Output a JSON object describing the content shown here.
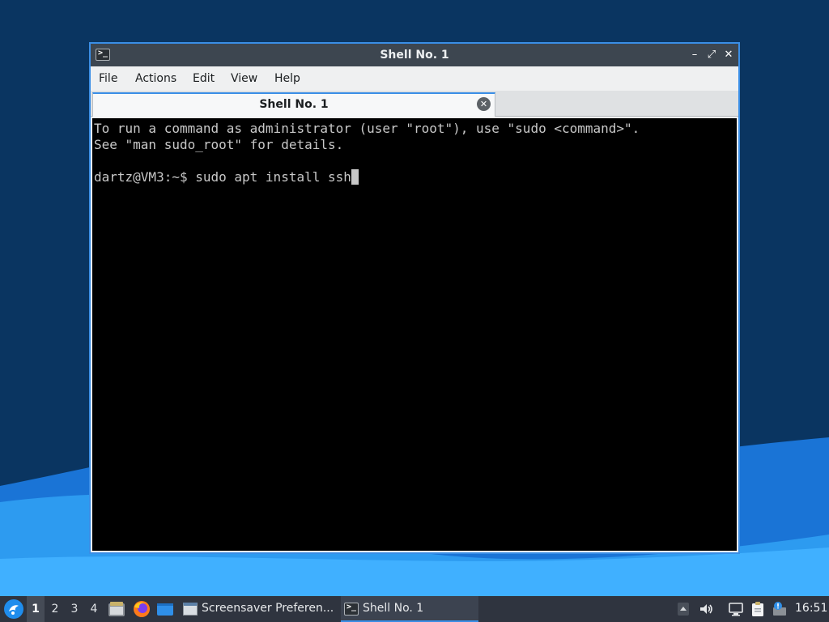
{
  "window": {
    "title": "Shell No. 1",
    "buttons": {
      "minimize": "–",
      "maximize": "⤢",
      "close": "✕"
    }
  },
  "menu": {
    "items": [
      {
        "label": "File"
      },
      {
        "label": "Actions"
      },
      {
        "label": "Edit"
      },
      {
        "label": "View"
      },
      {
        "label": "Help"
      }
    ]
  },
  "tabs": [
    {
      "label": "Shell No. 1",
      "active": true
    }
  ],
  "terminal": {
    "lines": [
      "To run a command as administrator (user \"root\"), use \"sudo <command>\".",
      "See \"man sudo_root\" for details.",
      "",
      "dartz@VM3:~$ sudo apt install ssh"
    ],
    "text_color": "#c8c8c8",
    "background": "#000000"
  },
  "taskbar": {
    "workspaces": [
      "1",
      "2",
      "3",
      "4"
    ],
    "active_workspace": "1",
    "launchers": [
      "file-manager-icon",
      "firefox-icon",
      "show-desktop-icon"
    ],
    "tasks": [
      {
        "label": "Screensaver Preferen...",
        "icon": "screensaver-window-icon"
      },
      {
        "label": "Shell No. 1",
        "icon": "terminal-icon",
        "active": true
      }
    ],
    "tray": [
      "tray-expand-icon",
      "volume-icon",
      "network-icon",
      "clipboard-icon",
      "notification-icon"
    ],
    "clock": "16:51"
  },
  "colors": {
    "accent": "#3a8ee6",
    "titlebar": "#3d4650",
    "taskbar": "#2f343f",
    "desktop": "#0a3561"
  }
}
